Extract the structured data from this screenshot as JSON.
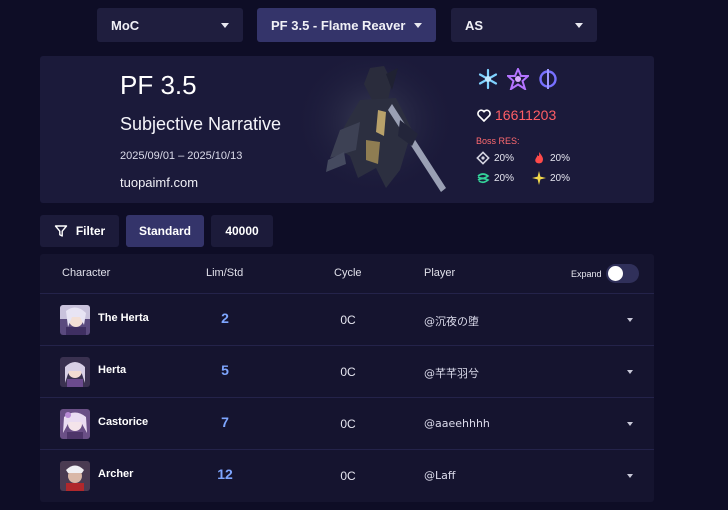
{
  "selectors": {
    "mode": "MoC",
    "version": "PF 3.5 - Flame Reaver",
    "side": "AS"
  },
  "hero": {
    "title": "PF 3.5",
    "subtitle": "Subjective Narrative",
    "dates": "2025/09/01 – 2025/10/13",
    "site": "tuopaimf.com",
    "weakness_icons": [
      "ice-icon",
      "imaginary-icon",
      "quantum-icon"
    ],
    "hp_icon": "heart-icon",
    "hp": "16611203",
    "boss_res_label": "Boss RES:",
    "resistances": [
      {
        "icon": "physical-icon",
        "value": "20%"
      },
      {
        "icon": "fire-icon",
        "value": "20%"
      },
      {
        "icon": "wind-icon",
        "value": "20%"
      },
      {
        "icon": "lightning-icon",
        "value": "20%"
      }
    ]
  },
  "filters": {
    "filter_label": "Filter",
    "standard_label": "Standard",
    "score_label": "40000"
  },
  "table": {
    "headers": {
      "character": "Character",
      "lim_std": "Lim/Std",
      "cycle": "Cycle",
      "player": "Player",
      "expand": "Expand"
    },
    "expand_on": false,
    "rows": [
      {
        "character": "The Herta",
        "lim": "2",
        "cycle": "0C",
        "player": "@沉夜の堕"
      },
      {
        "character": "Herta",
        "lim": "5",
        "cycle": "0C",
        "player": "@芊芊羽兮"
      },
      {
        "character": "Castorice",
        "lim": "7",
        "cycle": "0C",
        "player": "@aaeehhhh"
      },
      {
        "character": "Archer",
        "lim": "12",
        "cycle": "0C",
        "player": "@Laff"
      }
    ]
  },
  "colors": {
    "background": "#0e0d26",
    "panel": "#1b1a3a",
    "accent_blue": "#7ea6ff",
    "hp_red": "#ff5e66"
  }
}
